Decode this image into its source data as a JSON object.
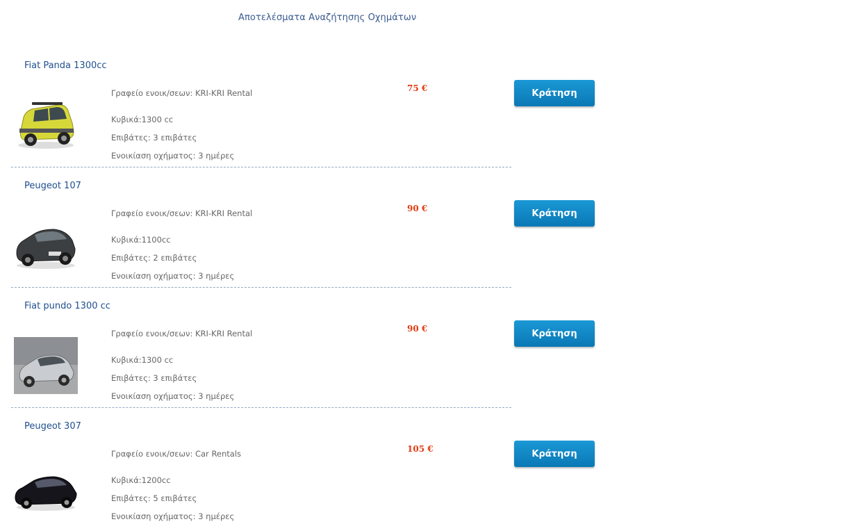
{
  "page": {
    "title": "Αποτελέσματα Αναζήτησης Οχημάτων"
  },
  "colors": {
    "title": "#3a5a8f",
    "car_name": "#1f4f8f",
    "price": "#e23a12",
    "button": "#0a82c0",
    "divider": "#8fa9bf"
  },
  "results": [
    {
      "name": "Fiat Panda 1300cc",
      "office": "Γραφείο ενοικ/σεων: KRI-KRI Rental",
      "cc": "Κυβικά:1300 cc",
      "passengers": "Επιβάτες: 3 επιβάτες",
      "rental": "Ενοικίαση οχήματος: 3 ημέρες",
      "price": "75 €",
      "book_label": "Κράτηση",
      "image_icon": "yellow-fiat-panda-image"
    },
    {
      "name": "Peugeot 107",
      "office": "Γραφείο ενοικ/σεων: KRI-KRI Rental",
      "cc": "Κυβικά:1100cc",
      "passengers": "Επιβάτες: 2 επιβάτες",
      "rental": "Ενοικίαση οχήματος: 3 ημέρες",
      "price": "90 €",
      "book_label": "Κράτηση",
      "image_icon": "dark-grey-peugeot-107-image"
    },
    {
      "name": "Fiat pundo 1300 cc",
      "office": "Γραφείο ενοικ/σεων: KRI-KRI Rental",
      "cc": "Κυβικά:1300 cc",
      "passengers": "Επιβάτες: 3 επιβάτες",
      "rental": "Ενοικίαση οχήματος: 3 ημέρες",
      "price": "90 €",
      "book_label": "Κράτηση",
      "image_icon": "silver-fiat-punto-image"
    },
    {
      "name": "Peugeot 307",
      "office": "Γραφείο ενοικ/σεων: Car Rentals",
      "cc": "Κυβικά:1200cc",
      "passengers": "Επιβάτες: 5 επιβάτες",
      "rental": "Ενοικίαση οχήματος: 3 ημέρες",
      "price": "105 €",
      "book_label": "Κράτηση",
      "image_icon": "black-peugeot-307-image"
    }
  ]
}
